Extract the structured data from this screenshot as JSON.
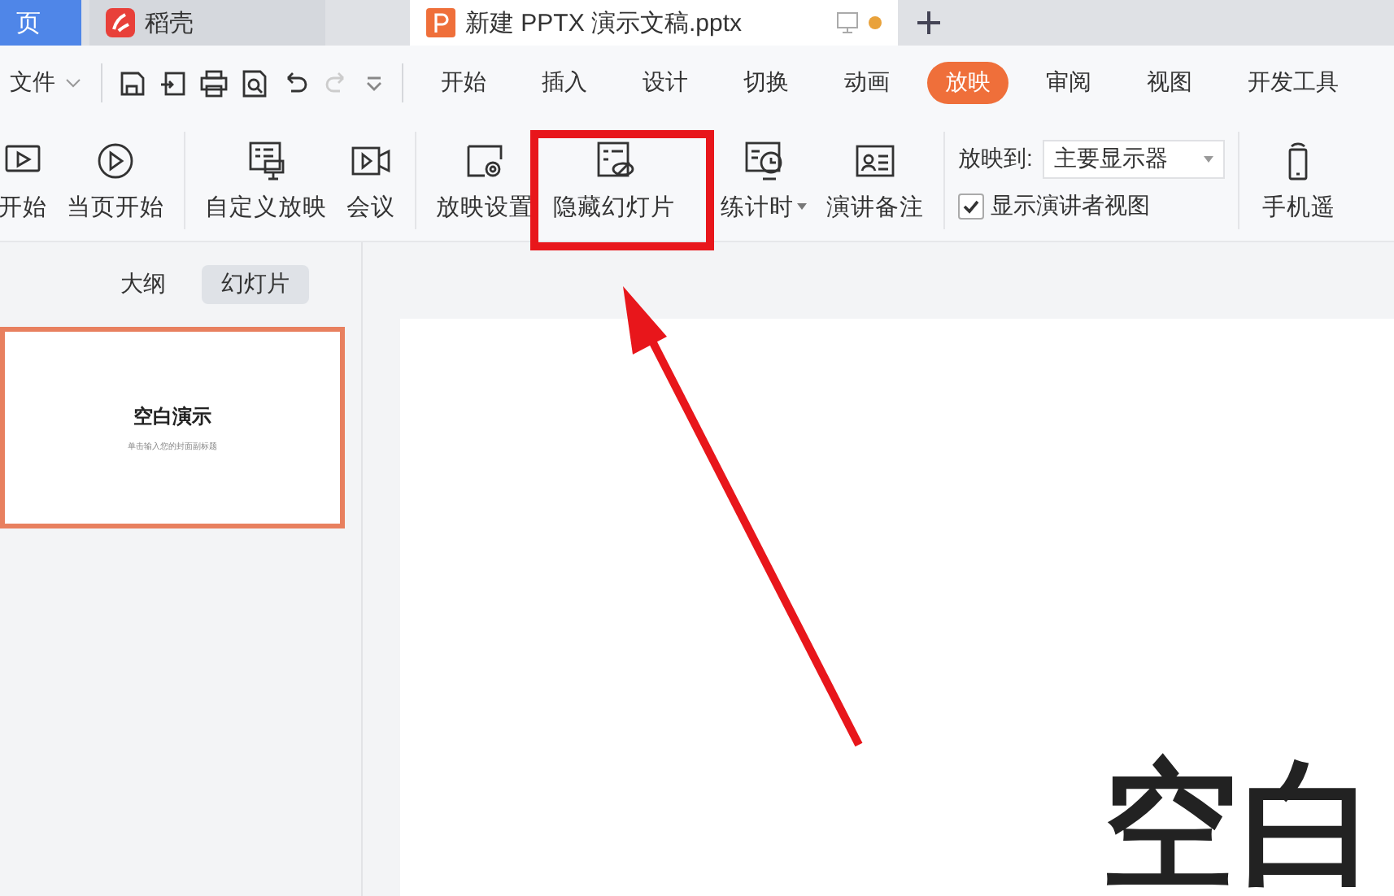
{
  "tabs": [
    {
      "label": "页",
      "kind": "home",
      "selected": false
    },
    {
      "label": "稻壳",
      "kind": "docer",
      "selected": false
    },
    {
      "label": "新建 PPTX 演示文稿.pptx",
      "kind": "document",
      "selected": true,
      "unsaved": true
    }
  ],
  "menu": {
    "file": "文件",
    "tabs": [
      {
        "label": "开始",
        "selected": false
      },
      {
        "label": "插入",
        "selected": false
      },
      {
        "label": "设计",
        "selected": false
      },
      {
        "label": "切换",
        "selected": false
      },
      {
        "label": "动画",
        "selected": false
      },
      {
        "label": "放映",
        "selected": true
      },
      {
        "label": "审阅",
        "selected": false
      },
      {
        "label": "视图",
        "selected": false
      },
      {
        "label": "开发工具",
        "selected": false
      }
    ]
  },
  "ribbon": {
    "groups": [
      {
        "buttons": [
          {
            "label": "开始",
            "kind": "play-start"
          },
          {
            "label": "当页开始",
            "kind": "play"
          }
        ]
      },
      {
        "buttons": [
          {
            "label": "自定义放映",
            "kind": "custom"
          },
          {
            "label": "会议",
            "kind": "video"
          }
        ]
      },
      {
        "buttons": [
          {
            "label": "放映设置",
            "kind": "settings"
          },
          {
            "label": "隐藏幻灯片",
            "kind": "hide",
            "highlighted": true
          },
          {
            "label": "练计时",
            "kind": "timer",
            "dropdown": true
          },
          {
            "label": "演讲备注",
            "kind": "notes"
          }
        ]
      }
    ],
    "show_to": {
      "label": "放映到:",
      "value": "主要显示器"
    },
    "presenter_view": {
      "label": "显示演讲者视图",
      "checked": true
    },
    "remote": {
      "label": "手机遥"
    }
  },
  "panel": {
    "tabs": [
      {
        "label": "大纲",
        "selected": false
      },
      {
        "label": "幻灯片",
        "selected": true
      }
    ],
    "slides": [
      {
        "title": "空白演示",
        "subtitle": "单击输入您的封面副标题",
        "selected": true
      }
    ]
  },
  "editor": {
    "slide_title": "空白"
  }
}
